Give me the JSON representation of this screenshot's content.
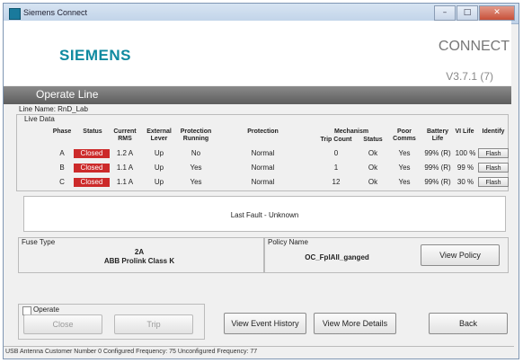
{
  "window": {
    "title": "Siemens Connect",
    "buttons": [
      "–",
      "□",
      "✕"
    ]
  },
  "header": {
    "logo": "SIEMENS",
    "product": "CONNECT",
    "version": "V3.7.1 (7)"
  },
  "section_title": "Operate Line",
  "line_name": "Line Name: RnD_Lab",
  "live_data_label": "Live Data",
  "columns": {
    "phase": "Phase",
    "status": "Status",
    "current_rms": "Current RMS",
    "external_lever": "External Lever",
    "protection_running": "Protection Running",
    "protection": "Protection",
    "mechanism": "Mechanism",
    "trip_count": "Trip Count",
    "mech_status": "Status",
    "poor_comms": "Poor Comms",
    "battery_life": "Battery Life",
    "vi_life": "VI Life",
    "identify": "Identify"
  },
  "rows": [
    {
      "phase": "A",
      "status": "Closed",
      "current": "1.2 A",
      "lever": "Up",
      "prot_running": "No",
      "protection": "Normal",
      "trip_count": "0",
      "mech_status": "Ok",
      "poor_comms": "Yes",
      "battery": "99% (R)",
      "vi": "100 %",
      "identify": "Flash"
    },
    {
      "phase": "B",
      "status": "Closed",
      "current": "1.1 A",
      "lever": "Up",
      "prot_running": "Yes",
      "protection": "Normal",
      "trip_count": "1",
      "mech_status": "Ok",
      "poor_comms": "Yes",
      "battery": "99% (R)",
      "vi": "99 %",
      "identify": "Flash"
    },
    {
      "phase": "C",
      "status": "Closed",
      "current": "1.1 A",
      "lever": "Up",
      "prot_running": "Yes",
      "protection": "Normal",
      "trip_count": "12",
      "mech_status": "Ok",
      "poor_comms": "Yes",
      "battery": "99% (R)",
      "vi": "30 %",
      "identify": "Flash"
    }
  ],
  "last_fault": "Last Fault - Unknown",
  "fuse": {
    "label": "Fuse Type",
    "rating": "2A",
    "name": "ABB Prolink Class K"
  },
  "policy": {
    "label": "Policy Name",
    "name": "OC_FplAll_ganged",
    "button": "View Policy"
  },
  "operate": {
    "checkbox_label": "Operate",
    "close": "Close",
    "trip": "Trip"
  },
  "actions": {
    "event_history": "View Event History",
    "more_details": "View More Details",
    "back": "Back"
  },
  "status_bar": "USB Antenna Customer Number 0 Configured Frequency: 75 Unconfigured Frequency: 77",
  "colors": {
    "closed_status": "#cc2a2a",
    "logo": "#0f8aa0",
    "section_bar": "#6e6e6e"
  }
}
